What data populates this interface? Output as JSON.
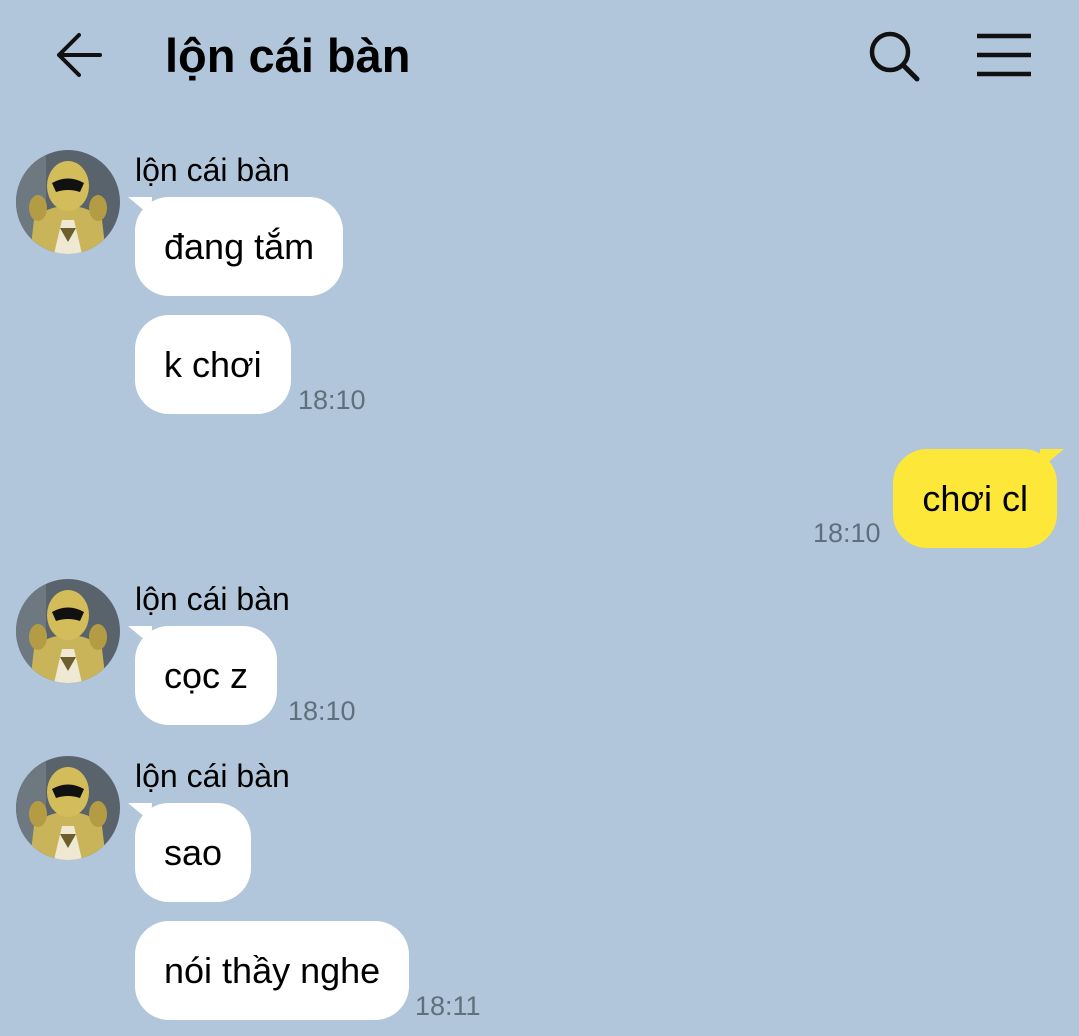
{
  "header": {
    "back_icon": "arrow-left-icon",
    "title": "lộn cái bàn",
    "search_icon": "search-icon",
    "menu_icon": "hamburger-menu-icon"
  },
  "colors": {
    "background": "#b1c6da",
    "incoming_bubble": "#ffffff",
    "outgoing_bubble": "#fde83a",
    "timestamp": "#5f6f7d"
  },
  "messages": [
    {
      "direction": "incoming",
      "sender": "lộn cái bàn",
      "text": "đang tắm",
      "time": ""
    },
    {
      "direction": "incoming",
      "sender": "",
      "text": "k chơi",
      "time": "18:10"
    },
    {
      "direction": "outgoing",
      "sender": "",
      "text": "chơi cl",
      "time": "18:10"
    },
    {
      "direction": "incoming",
      "sender": "lộn cái bàn",
      "text": "cọc z",
      "time": "18:10"
    },
    {
      "direction": "incoming",
      "sender": "lộn cái bàn",
      "text": "sao",
      "time": ""
    },
    {
      "direction": "incoming",
      "sender": "",
      "text": "nói thầy nghe",
      "time": "18:11"
    }
  ]
}
